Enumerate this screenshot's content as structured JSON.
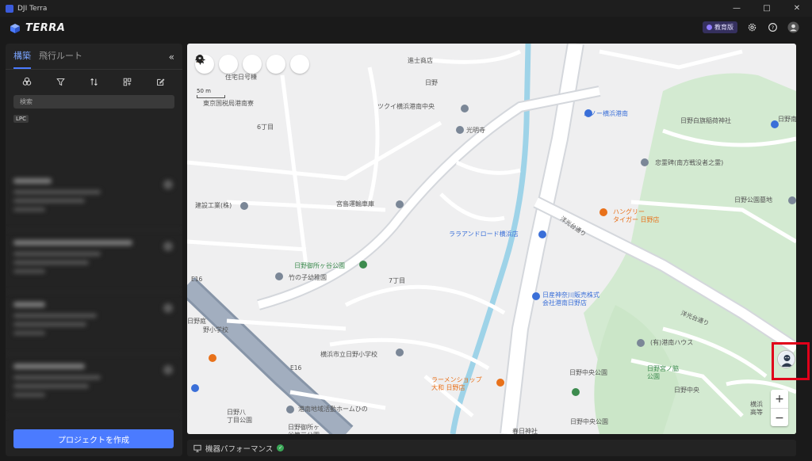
{
  "window": {
    "title": "DJI Terra",
    "controls": [
      "minimize-icon",
      "maximize-icon",
      "close-icon"
    ]
  },
  "appbar": {
    "brand": "TERRA",
    "edition_badge": "教育版",
    "icons": [
      "settings-icon",
      "help-icon",
      "user-icon"
    ]
  },
  "sidebar": {
    "tabs": [
      {
        "label": "構築",
        "active": true
      },
      {
        "label": "飛行ルート",
        "active": false
      }
    ],
    "collapse_icon": "double-chevron-left-icon",
    "tools": [
      "group-icon",
      "filter-icon",
      "sort-icon",
      "select-icon",
      "edit-icon"
    ],
    "search_placeholder": "検索",
    "tag": "LPC",
    "create_button": "プロジェクトを作成"
  },
  "map": {
    "toolbar": [
      "compass-icon",
      "locate-icon",
      "pin-icon",
      "list-icon",
      "search-icon"
    ],
    "scale_label": "50 m",
    "labels": {
      "shop1": "進士商店",
      "hino": "日野",
      "tsukui": "ツクイ横浜港南中央",
      "rinno": "ルノー横浜港南",
      "komyoji": "光明寺",
      "hino_shirahata": "日野白旗稲荷神社",
      "hino_minami": "日野南",
      "chukonhi": "忠霊碑(南方戦没者之霊)",
      "kokuzei": "東京国税局港南寮",
      "juutaku": "住宅日号棟",
      "chome6": "6丁目",
      "kensetsu": "建設工業(株)",
      "miyajima": "宮島運輸車庫",
      "hungry": "ハングリー\nタイガー 日野店",
      "hino_koen": "日野公園墓地",
      "laura": "ララアンドロード横浜店",
      "yoko_road": "洋光台通り",
      "gotanda": "日野御所ヶ谷公園",
      "takenoko": "竹の子幼稚園",
      "chome7": "7丁目",
      "nissan": "日産神奈川販売株式\n会社港南日野店",
      "road2": "洋光台通り",
      "konan_house": "(有)港南ハウス",
      "miyanowaki": "日野宮ノ脇\n公園",
      "hino_chuo_koen": "日野中央公園",
      "hino_chuo": "日野中央",
      "hino_sho": "横浜市立日野小学校",
      "ramen": "ラーメンショップ\n大和 日野店",
      "hinohachi": "日野八\n丁目公園",
      "konan_center": "港南地域活動ホームひの",
      "gotanda2": "日野御所ヶ\n谷第三公園",
      "hino_chuo_koen2": "日野中央公園",
      "kasuga": "春日神社",
      "yoko_koko": "横浜\n高等",
      "hinosho2": "野小学校",
      "hino_elem_area": "日野庭",
      "e16": "E16",
      "kasayama": "公"
    }
  },
  "footer": {
    "performance_label": "機器パフォーマンス"
  }
}
